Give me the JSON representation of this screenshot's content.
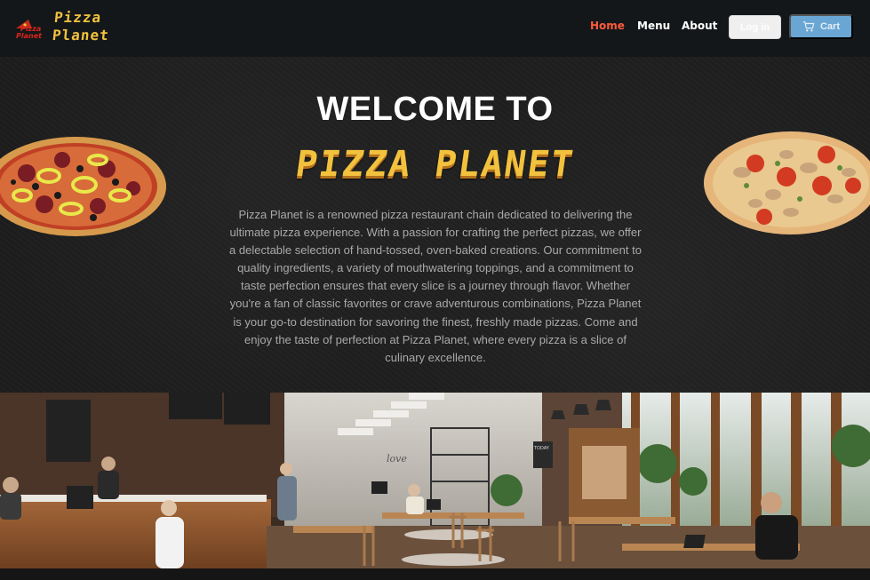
{
  "brand": {
    "logo_text": [
      "Pizza",
      "Planet"
    ],
    "name_lines": [
      "Pizza",
      "Planet"
    ]
  },
  "nav": {
    "links": [
      {
        "label": "Home",
        "active": true
      },
      {
        "label": "Menu",
        "active": false
      },
      {
        "label": "About",
        "active": false
      }
    ],
    "login_label": "Log in",
    "cart_label": "Cart",
    "cart_icon": "cart-icon"
  },
  "hero": {
    "welcome": "WELCOME TO",
    "brand": "PIZZA PLANET",
    "description": "Pizza Planet is a renowned pizza restaurant chain dedicated to delivering the ultimate pizza experience. With a passion for crafting the perfect pizzas, we offer a delectable selection of hand-tossed, oven-baked creations. Our commitment to quality ingredients, a variety of mouthwatering toppings, and a commitment to taste perfection ensures that every slice is a journey through flavor. Whether you're a fan of classic favorites or crave adventurous combinations, Pizza Planet is your go-to destination for savoring the finest, freshly made pizzas. Come and enjoy the taste of perfection at Pizza Planet, where every pizza is a slice of culinary excellence."
  },
  "photo": {
    "wall_text": "love",
    "sign_text": "TODAY"
  },
  "colors": {
    "accent": "#ff5b3a",
    "brand_yellow": "#f2c23e",
    "cart_blue": "#69a6d4",
    "navbar": "#14171a"
  }
}
